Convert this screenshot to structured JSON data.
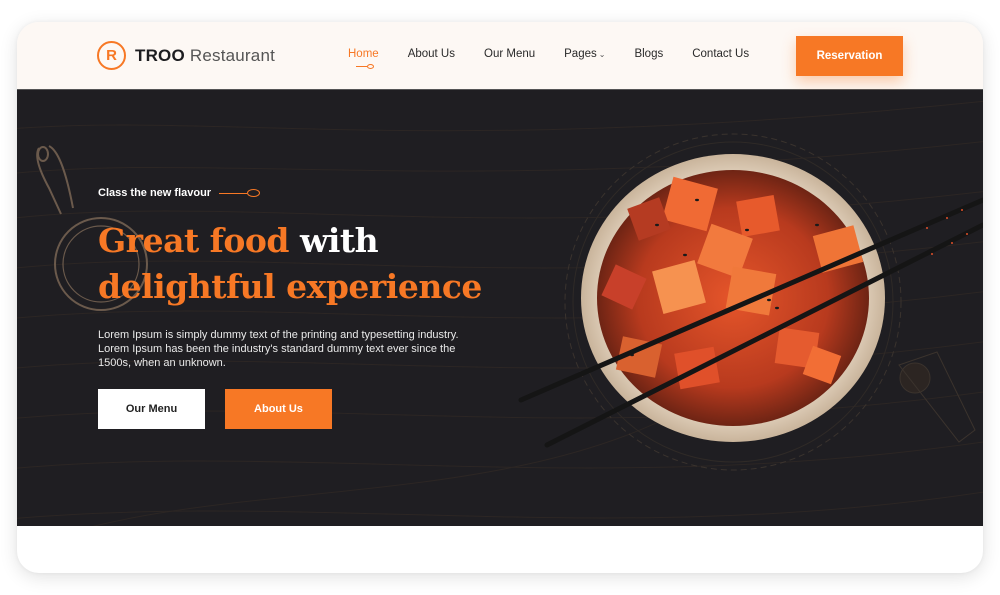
{
  "brand": {
    "logo_letter": "R",
    "name_bold": "TROO",
    "name_light": "Restaurant",
    "accent_color": "#f77825"
  },
  "nav": {
    "items": [
      {
        "label": "Home",
        "active": true
      },
      {
        "label": "About Us",
        "active": false
      },
      {
        "label": "Our Menu",
        "active": false
      },
      {
        "label": "Pages",
        "active": false,
        "dropdown": true
      },
      {
        "label": "Blogs",
        "active": false
      },
      {
        "label": "Contact Us",
        "active": false
      }
    ],
    "dropdown_icon": "chevron-down-icon",
    "cta_label": "Reservation"
  },
  "hero": {
    "tagline": "Class the new flavour",
    "headline_orange_1": "Great food",
    "headline_white": " with",
    "headline_orange_2": "delightful experience",
    "description": "Lorem Ipsum is simply dummy text of the printing and typesetting industry. Lorem Ipsum has been the industry's standard dummy text ever since the 1500s, when an unknown.",
    "primary_button": "Our Menu",
    "secondary_button": "About Us",
    "image_alt": "Bowl of diced tuna poke with chopsticks"
  }
}
